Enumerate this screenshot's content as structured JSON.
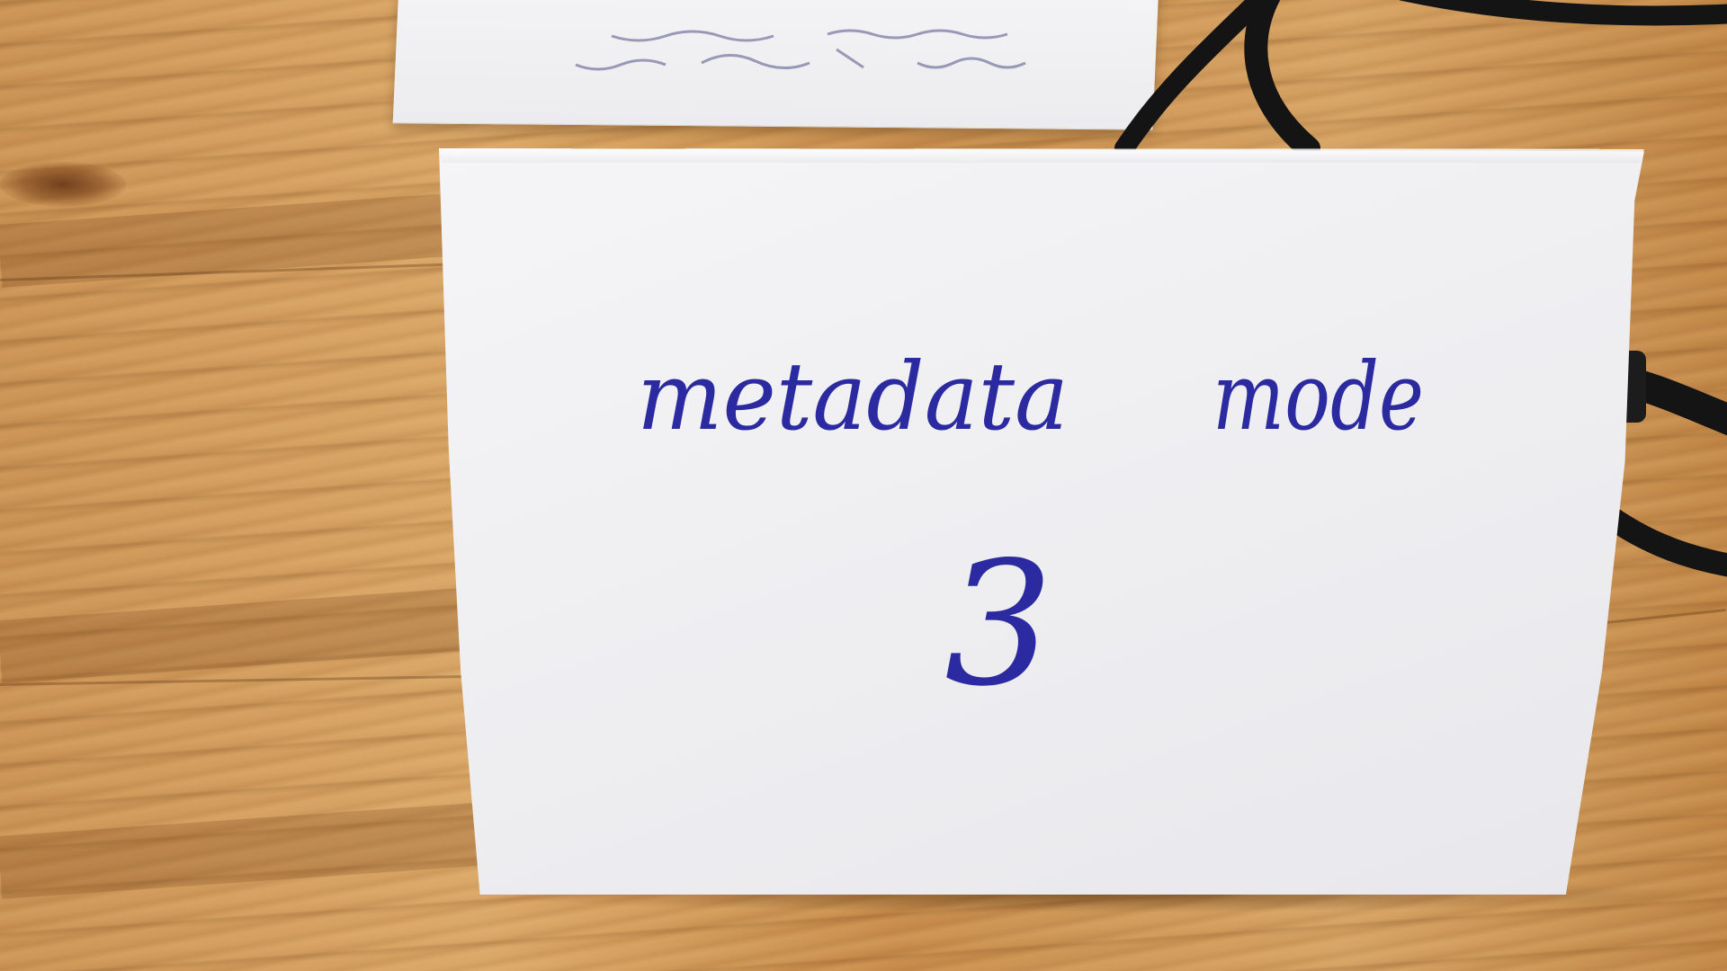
{
  "sign": {
    "line1_word1": "metadata",
    "line1_word2": "mode",
    "line2": "3"
  },
  "colors": {
    "ink": "#2b2aa0",
    "card": "#f0f0f3",
    "table": "#c99052",
    "cable": "#141414"
  }
}
